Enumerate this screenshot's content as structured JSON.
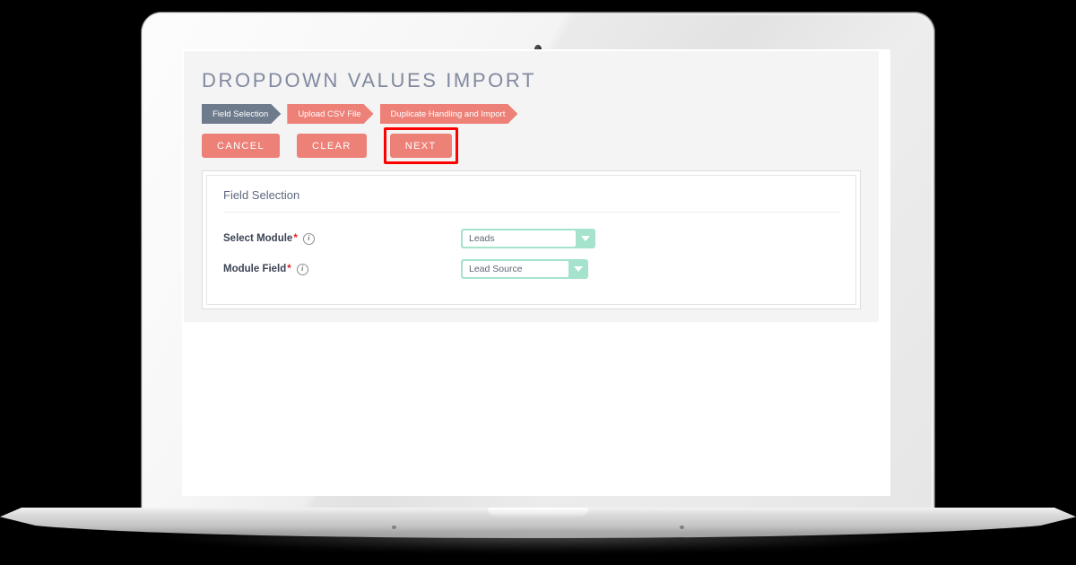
{
  "device": {
    "type": "laptop-mockup",
    "camera_icon": "camera-dot-icon"
  },
  "app": {
    "title": "DROPDOWN VALUES IMPORT",
    "steps": [
      {
        "label": "Field Selection",
        "state": "active",
        "color": "#6d7b8d"
      },
      {
        "label": "Upload CSV File",
        "state": "pending",
        "color": "#ed8177"
      },
      {
        "label": "Duplicate Handling and Import",
        "state": "pending",
        "color": "#ed8177"
      }
    ],
    "buttons": {
      "cancel": "CANCEL",
      "clear": "CLEAR",
      "next": "NEXT"
    },
    "highlight": {
      "target": "next",
      "color": "#ff0000"
    },
    "card": {
      "title": "Field Selection",
      "fields": [
        {
          "label": "Select Module",
          "required": "*",
          "info_icon": "info-circle-icon",
          "value": "Leads",
          "dropdown_icon": "chevron-down-icon"
        },
        {
          "label": "Module Field",
          "required": "*",
          "info_icon": "info-circle-icon",
          "value": "Lead Source",
          "dropdown_icon": "chevron-down-icon"
        }
      ]
    },
    "colors": {
      "accent": "#ed8177",
      "step_active": "#6d7b8d",
      "select_accent": "#a5e3cd",
      "title_text": "#8189a0",
      "panel_bg": "#f4f4f4"
    }
  }
}
